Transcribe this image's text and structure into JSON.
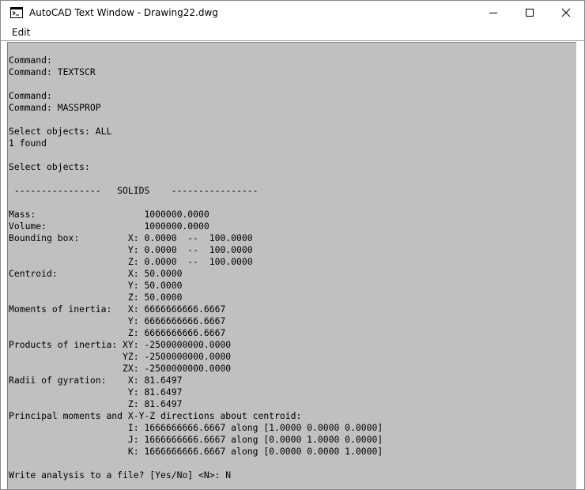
{
  "window": {
    "title": "AutoCAD Text Window - Drawing22.dwg",
    "icon": "terminal-icon",
    "controls": [
      "minimize-icon",
      "maximize-icon",
      "close-icon"
    ]
  },
  "menu": {
    "items": [
      {
        "label": "Edit"
      }
    ]
  },
  "colors": {
    "text_area_background": "#c0c0c0",
    "text_color": "#000000"
  },
  "console": {
    "lines": [
      "Command:",
      "Command: TEXTSCR",
      "",
      "Command:",
      "Command: MASSPROP",
      "",
      "Select objects: ALL",
      "1 found",
      "",
      "Select objects:",
      "",
      " ----------------   SOLIDS    ----------------",
      "",
      "Mass:                    1000000.0000",
      "Volume:                  1000000.0000",
      "Bounding box:         X: 0.0000  --  100.0000",
      "                      Y: 0.0000  --  100.0000",
      "                      Z: 0.0000  --  100.0000",
      "Centroid:             X: 50.0000",
      "                      Y: 50.0000",
      "                      Z: 50.0000",
      "Moments of inertia:   X: 6666666666.6667",
      "                      Y: 6666666666.6667",
      "                      Z: 6666666666.6667",
      "Products of inertia: XY: -2500000000.0000",
      "                     YZ: -2500000000.0000",
      "                     ZX: -2500000000.0000",
      "Radii of gyration:    X: 81.6497",
      "                      Y: 81.6497",
      "                      Z: 81.6497",
      "Principal moments and X-Y-Z directions about centroid:",
      "                      I: 1666666666.6667 along [1.0000 0.0000 0.0000]",
      "                      J: 1666666666.6667 along [0.0000 1.0000 0.0000]",
      "                      K: 1666666666.6667 along [0.0000 0.0000 1.0000]",
      "",
      "Write analysis to a file? [Yes/No] <N>: N"
    ]
  }
}
